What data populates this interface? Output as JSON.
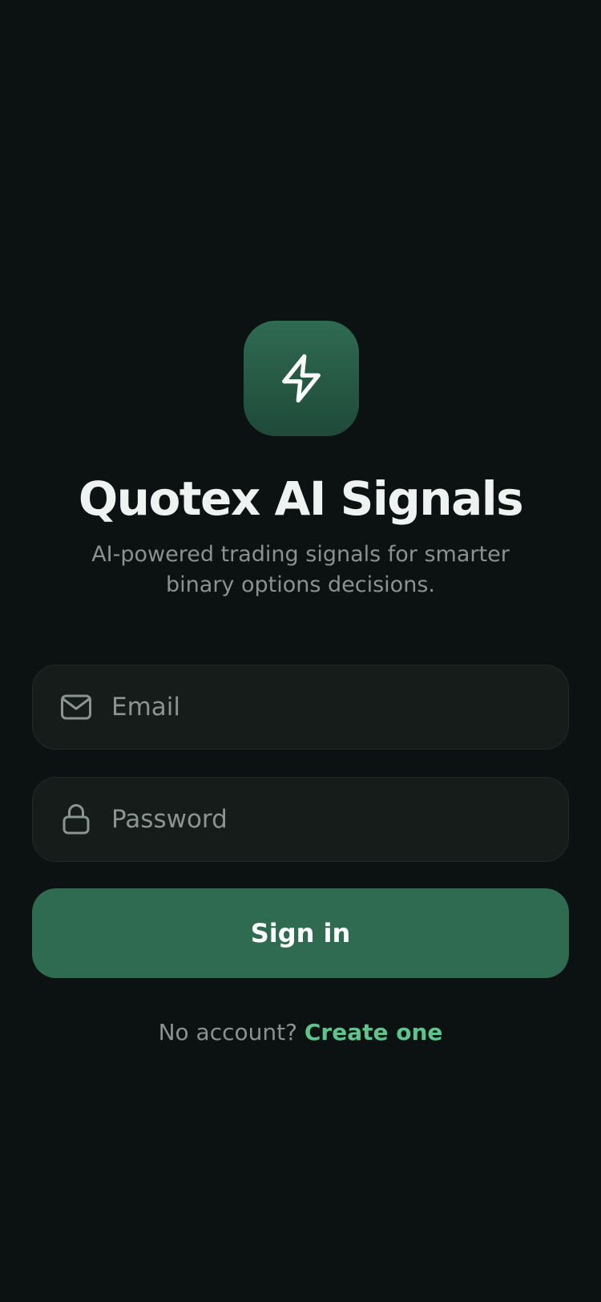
{
  "app": {
    "title": "Quotex AI Signals",
    "subtitle": "AI-powered trading signals for smarter binary options decisions.",
    "logo_icon": "lightning-bolt-icon"
  },
  "form": {
    "email": {
      "placeholder": "Email",
      "value": "",
      "icon": "mail-icon"
    },
    "password": {
      "placeholder": "Password",
      "value": "",
      "icon": "lock-icon"
    },
    "submit_label": "Sign in"
  },
  "footer": {
    "prompt": "No account?",
    "link_label": "Create one"
  },
  "colors": {
    "background": "#0c1211",
    "accent": "#2f6b50",
    "link": "#5cc48c",
    "field_bg": "#151c1a"
  }
}
